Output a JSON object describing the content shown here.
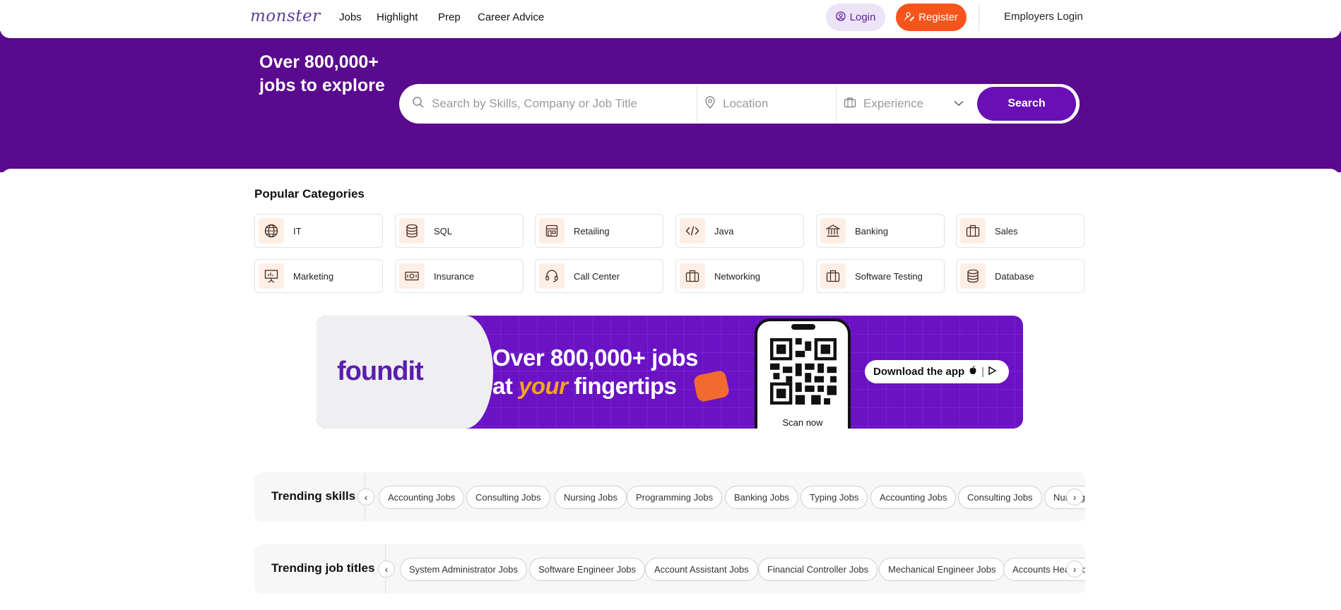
{
  "header": {
    "brand": "monster",
    "nav": [
      "Jobs",
      "Highlight",
      "Prep",
      "Career Advice"
    ],
    "login_label": "Login",
    "register_label": "Register",
    "employers_label": "Employers Login"
  },
  "hero": {
    "title_line1": "Over 800,000+",
    "title_line2": "jobs to explore",
    "search": {
      "skills_placeholder": "Search by Skills, Company or Job Title",
      "location_placeholder": "Location",
      "experience_placeholder": "Experience",
      "button_label": "Search"
    }
  },
  "categories": {
    "title": "Popular Categories",
    "items": [
      {
        "label": "IT",
        "icon": "globe-icon"
      },
      {
        "label": "SQL",
        "icon": "database-icon"
      },
      {
        "label": "Retailing",
        "icon": "store-icon"
      },
      {
        "label": "Java",
        "icon": "code-icon"
      },
      {
        "label": "Banking",
        "icon": "bank-icon"
      },
      {
        "label": "Sales",
        "icon": "briefcase-icon"
      },
      {
        "label": "Marketing",
        "icon": "presentation-icon"
      },
      {
        "label": "Insurance",
        "icon": "money-icon"
      },
      {
        "label": "Call Center",
        "icon": "headset-icon"
      },
      {
        "label": "Networking",
        "icon": "briefcase-icon"
      },
      {
        "label": "Software Testing",
        "icon": "briefcase-icon"
      },
      {
        "label": "Database",
        "icon": "database-icon"
      }
    ]
  },
  "banner": {
    "logo_text": "foundit",
    "headline_line1": "Over 800,000+ jobs",
    "headline_at": "at",
    "headline_your": "your",
    "headline_rest": "fingertips",
    "scan_label": "Scan now",
    "download_label": "Download the app",
    "colors": {
      "purple": "#6a12c4",
      "orange": "#f4a224"
    }
  },
  "trending_skills": {
    "title": "Trending skills",
    "chips": [
      "Accounting Jobs",
      "Consulting Jobs",
      "Nursing Jobs",
      "Programming Jobs",
      "Banking Jobs",
      "Typing Jobs",
      "Accounting Jobs",
      "Consulting Jobs",
      "Nursing Jobs"
    ]
  },
  "trending_titles": {
    "title": "Trending job titles",
    "chips": [
      "System Administrator Jobs",
      "Software Engineer Jobs",
      "Account Assistant Jobs",
      "Financial Controller Jobs",
      "Mechanical Engineer Jobs",
      "Accounts Head Jobs"
    ]
  },
  "colors": {
    "hero_bg": "#5a0a8e",
    "primary": "#6a0fb6",
    "register_bg": "#f7541b",
    "login_bg": "#ede3f7"
  }
}
